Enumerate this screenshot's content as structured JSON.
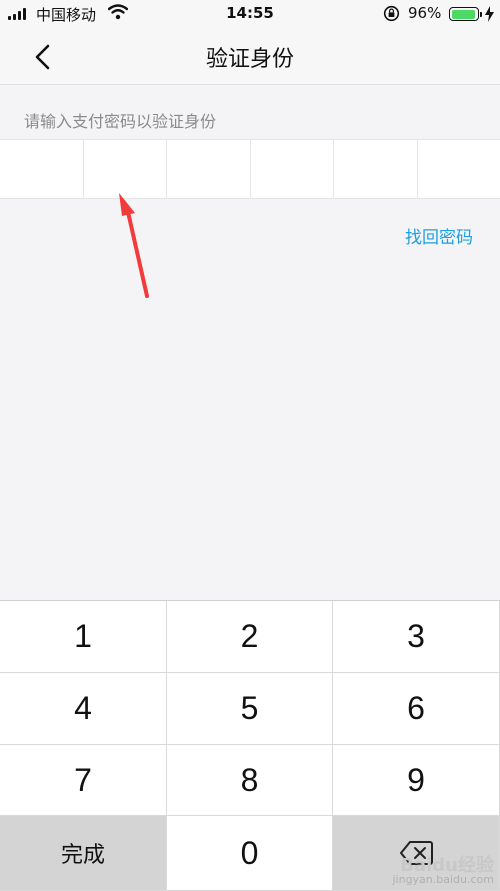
{
  "status_bar": {
    "carrier": "中国移动",
    "time": "14:55",
    "battery_percent": "96%",
    "battery_level": 0.96,
    "battery_color": "#4cd964"
  },
  "nav": {
    "back_icon": "chevron-left-icon",
    "title": "验证身份"
  },
  "hint": "请输入支付密码以验证身份",
  "password": {
    "digit_count": 6,
    "entered": 0
  },
  "forgot_password": "找回密码",
  "accent_color": "#1f9ee0",
  "annotation": {
    "type": "red-arrow",
    "color": "#f23b3b"
  },
  "keypad": {
    "keys": [
      "1",
      "2",
      "3",
      "4",
      "5",
      "6",
      "7",
      "8",
      "9"
    ],
    "done_label": "完成",
    "zero": "0",
    "delete_icon": "backspace-icon"
  },
  "watermark": {
    "brand": "Baidu经验",
    "url": "jingyan.baidu.com"
  }
}
